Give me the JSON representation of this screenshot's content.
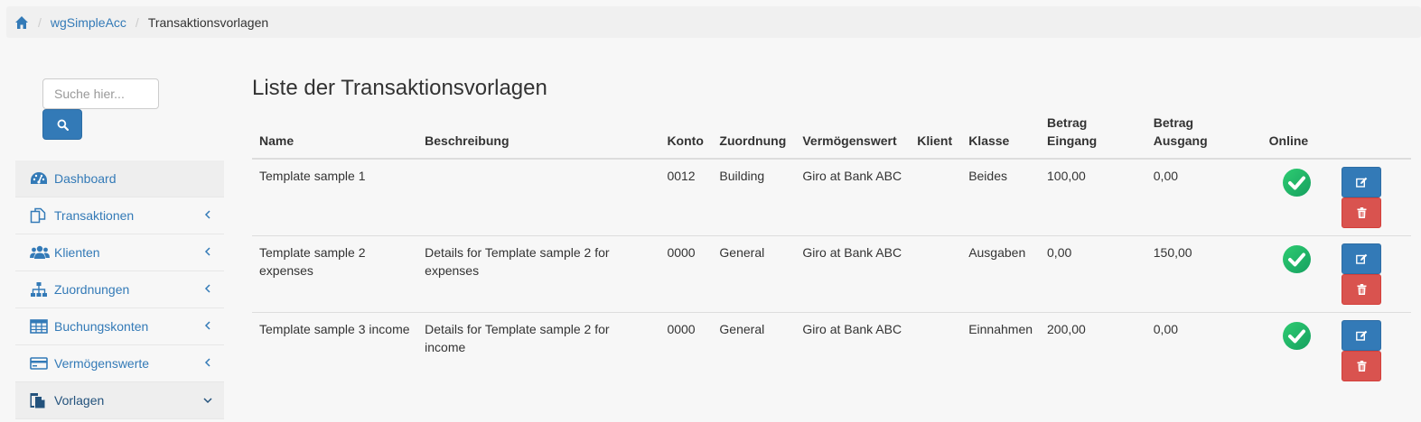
{
  "breadcrumb": {
    "home_icon": "home-icon",
    "items": [
      "wgSimpleAcc",
      "Transaktionsvorlagen"
    ]
  },
  "search": {
    "placeholder": "Suche hier...",
    "button_icon": "search-icon"
  },
  "sidebar": {
    "items": [
      {
        "label": "Dashboard",
        "icon": "dashboard-icon"
      },
      {
        "label": "Transaktionen",
        "icon": "copy-icon"
      },
      {
        "label": "Klienten",
        "icon": "users-icon"
      },
      {
        "label": "Zuordnungen",
        "icon": "sitemap-icon"
      },
      {
        "label": "Buchungskonten",
        "icon": "table-icon"
      },
      {
        "label": "Vermögenswerte",
        "icon": "credit-card-icon"
      },
      {
        "label": "Vorlagen",
        "icon": "file-copy-icon"
      }
    ]
  },
  "main": {
    "title": "Liste der Transaktionsvorlagen",
    "table": {
      "headers": [
        "Name",
        "Beschreibung",
        "Konto",
        "Zuordnung",
        "Vermögenswert",
        "Klient",
        "Klasse",
        "Betrag Eingang",
        "Betrag Ausgang",
        "Online"
      ],
      "rows": [
        {
          "name": "Template sample 1",
          "description": "",
          "account": "0012",
          "assignment": "Building",
          "asset": "Giro at Bank ABC",
          "client": "",
          "class": "Beides",
          "amount_in": "100,00",
          "amount_out": "0,00",
          "online": true
        },
        {
          "name": "Template sample 2 expenses",
          "description": "Details for Template sample 2 for expenses",
          "account": "0000",
          "assignment": "General",
          "asset": "Giro at Bank ABC",
          "client": "",
          "class": "Ausgaben",
          "amount_in": "0,00",
          "amount_out": "150,00",
          "online": true
        },
        {
          "name": "Template sample 3 income",
          "description": "Details for Template sample 2 for income",
          "account": "0000",
          "assignment": "General",
          "asset": "Giro at Bank ABC",
          "client": "",
          "class": "Einnahmen",
          "amount_in": "200,00",
          "amount_out": "0,00",
          "online": true
        }
      ]
    }
  },
  "colors": {
    "primary": "#337ab7",
    "danger": "#d9534f",
    "online_green": "#27ae60"
  }
}
